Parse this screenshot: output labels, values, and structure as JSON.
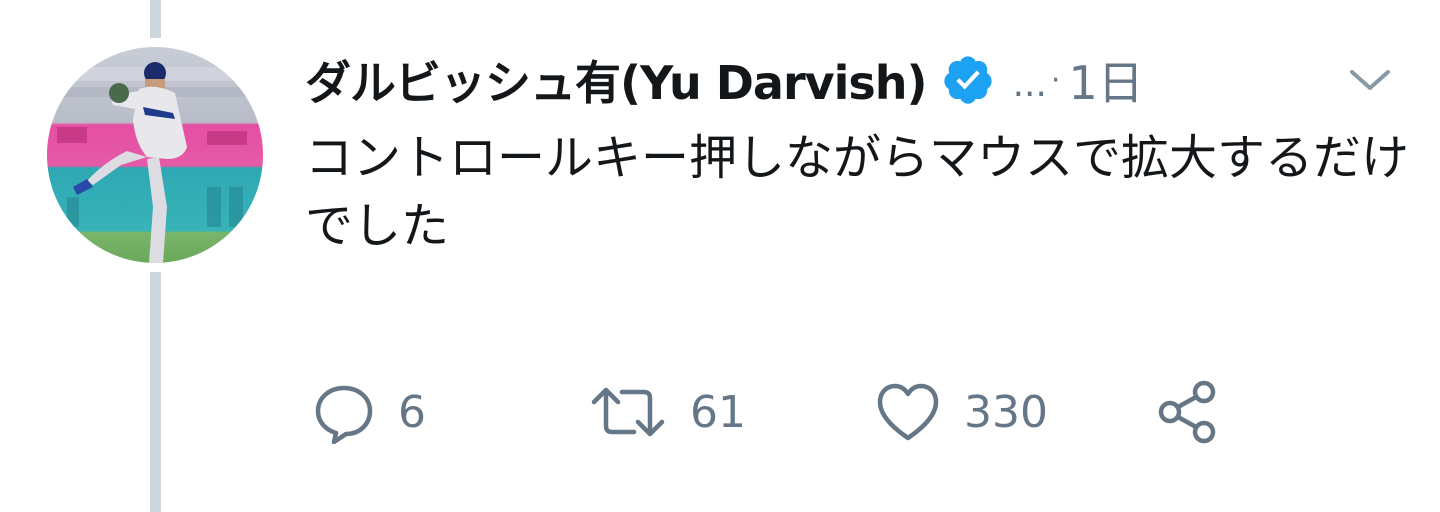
{
  "tweet": {
    "author": {
      "display_name": "ダルビッシュ有(Yu Darvish)",
      "verified": true,
      "avatar_icon": "baseball-pitcher-avatar"
    },
    "meta": {
      "ellipsis": "...",
      "separator": "·",
      "timestamp": "1日"
    },
    "text": "コントロールキー押しながらマウスで拡大するだけでした",
    "actions": {
      "reply_count": "6",
      "retweet_count": "61",
      "like_count": "330"
    }
  },
  "colors": {
    "text_primary": "#14171a",
    "text_secondary": "#657786",
    "verified_blue": "#1da1f2",
    "thread_line": "#ccd6dd"
  }
}
